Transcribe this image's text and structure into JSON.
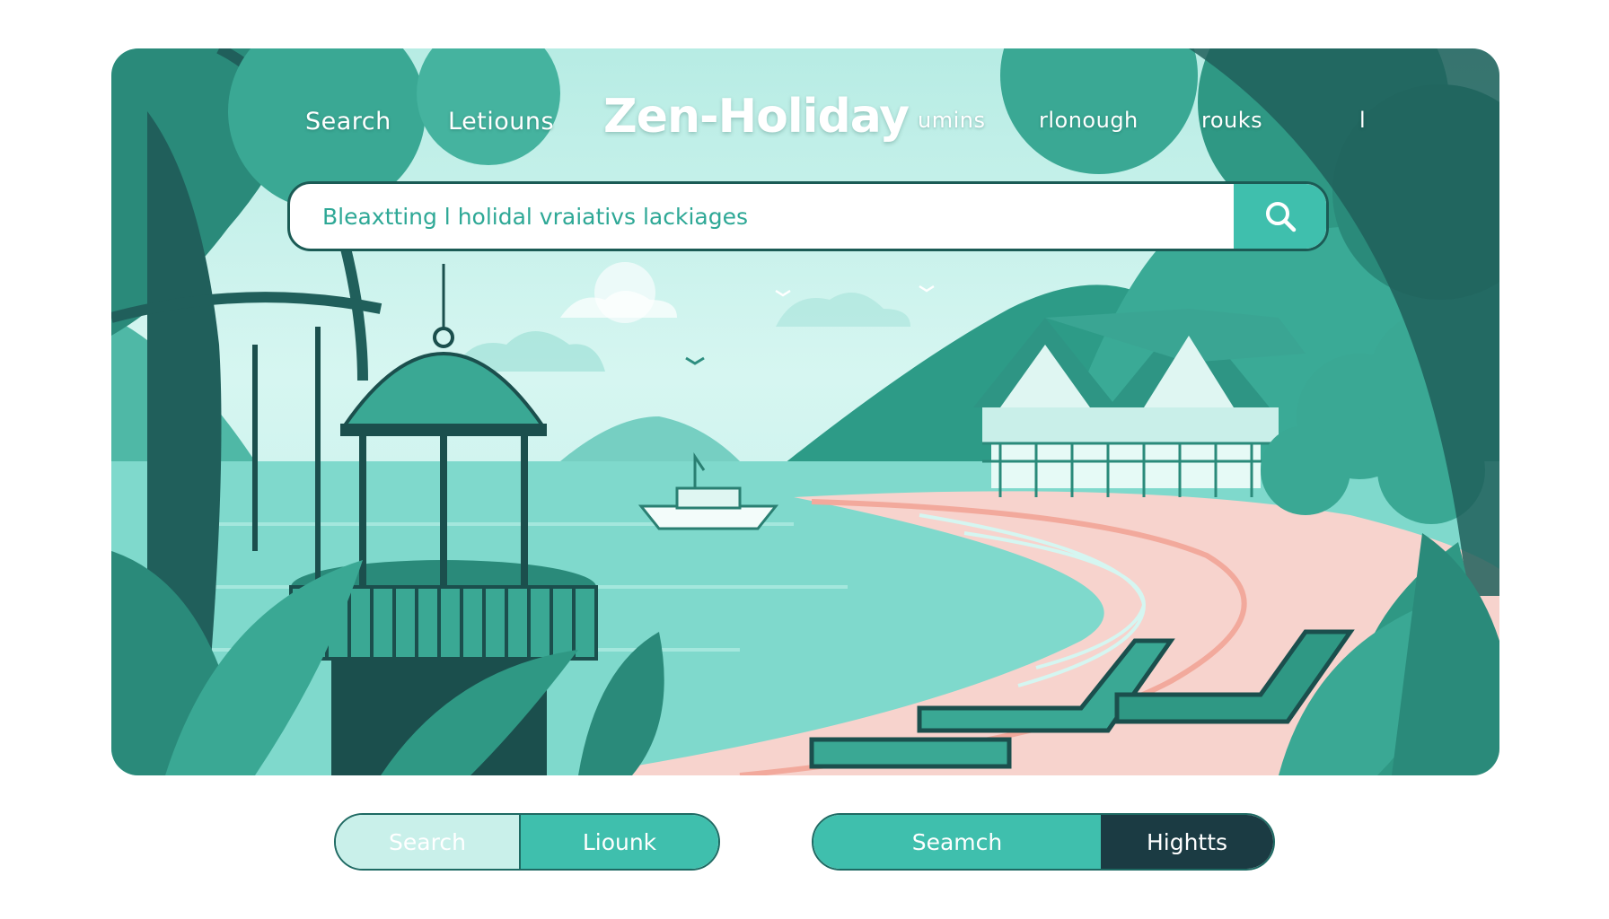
{
  "nav": {
    "links": [
      "Search",
      "Letiouns",
      "umins",
      "rlonough",
      "rouks",
      "l"
    ],
    "brand": "Zen-Holiday"
  },
  "search": {
    "placeholder": "Bleaxtting l holidal vraiativs lackiages"
  },
  "icons": {
    "search": "magnifier-icon"
  },
  "toggles": {
    "left": {
      "first": "Search",
      "second": "Liounk"
    },
    "right": {
      "first": "Seamch",
      "second": "Hightts"
    }
  },
  "colors": {
    "accent": "#3fbfad",
    "dark": "#1b3b43",
    "sea": "#7fd9cc",
    "foliage": "#2a8c7c",
    "sand": "#f7d3cd"
  }
}
